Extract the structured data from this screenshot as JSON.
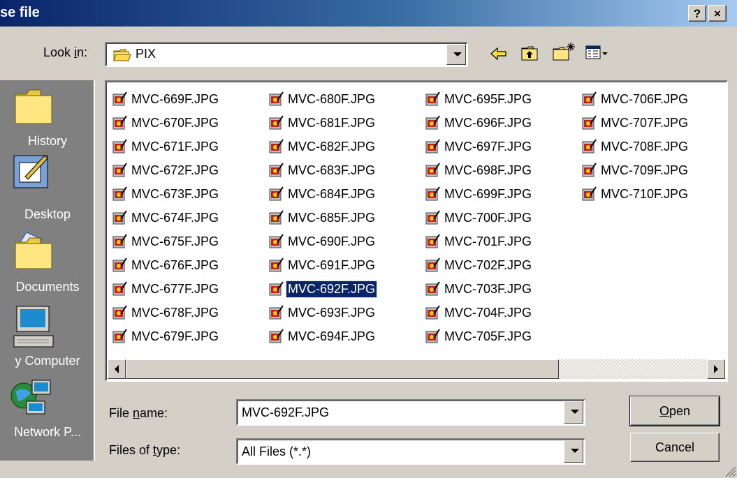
{
  "window": {
    "title": "se file",
    "help_btn": "?",
    "close_btn": "×"
  },
  "look_in": {
    "label_pre": "Look ",
    "label_acc": "i",
    "label_post": "n:",
    "value": "PIX"
  },
  "toolbar": {
    "back_icon": "back-arrow-icon",
    "up_icon": "up-folder-icon",
    "new_folder_icon": "new-folder-icon",
    "view_icon": "view-menu-icon"
  },
  "places": [
    {
      "label": "History",
      "icon": "history-icon"
    },
    {
      "label": "Desktop",
      "icon": "desktop-icon"
    },
    {
      "label": "Documents",
      "icon": "my-documents-icon"
    },
    {
      "label": "y Computer",
      "icon": "my-computer-icon"
    },
    {
      "label": "Network P...",
      "icon": "network-places-icon"
    }
  ],
  "files": {
    "col1": [
      "MVC-669F.JPG",
      "MVC-670F.JPG",
      "MVC-671F.JPG",
      "MVC-672F.JPG",
      "MVC-673F.JPG",
      "MVC-674F.JPG",
      "MVC-675F.JPG",
      "MVC-676F.JPG",
      "MVC-677F.JPG",
      "MVC-678F.JPG",
      "MVC-679F.JPG"
    ],
    "col2": [
      "MVC-680F.JPG",
      "MVC-681F.JPG",
      "MVC-682F.JPG",
      "MVC-683F.JPG",
      "MVC-684F.JPG",
      "MVC-685F.JPG",
      "MVC-690F.JPG",
      "MVC-691F.JPG",
      "MVC-692F.JPG",
      "MVC-693F.JPG",
      "MVC-694F.JPG"
    ],
    "col3": [
      "MVC-695F.JPG",
      "MVC-696F.JPG",
      "MVC-697F.JPG",
      "MVC-698F.JPG",
      "MVC-699F.JPG",
      "MVC-700F.JPG",
      "MVC-701F.JPG",
      "MVC-702F.JPG",
      "MVC-703F.JPG",
      "MVC-704F.JPG",
      "MVC-705F.JPG"
    ],
    "col4": [
      "MVC-706F.JPG",
      "MVC-707F.JPG",
      "MVC-708F.JPG",
      "MVC-709F.JPG",
      "MVC-710F.JPG"
    ]
  },
  "selected_file": "MVC-692F.JPG",
  "file_name": {
    "label_pre": "File ",
    "label_acc": "n",
    "label_post": "ame:",
    "value": "MVC-692F.JPG"
  },
  "file_type": {
    "label_pre": "Files of ",
    "label_acc": "t",
    "label_post": "ype:",
    "value": "All Files (*.*)"
  },
  "buttons": {
    "open_acc": "O",
    "open_rest": "pen",
    "cancel": "Cancel"
  },
  "colors": {
    "title_start": "#0a246a",
    "title_end": "#a6caf0",
    "selection": "#0a246a",
    "face": "#d4d0c8"
  }
}
